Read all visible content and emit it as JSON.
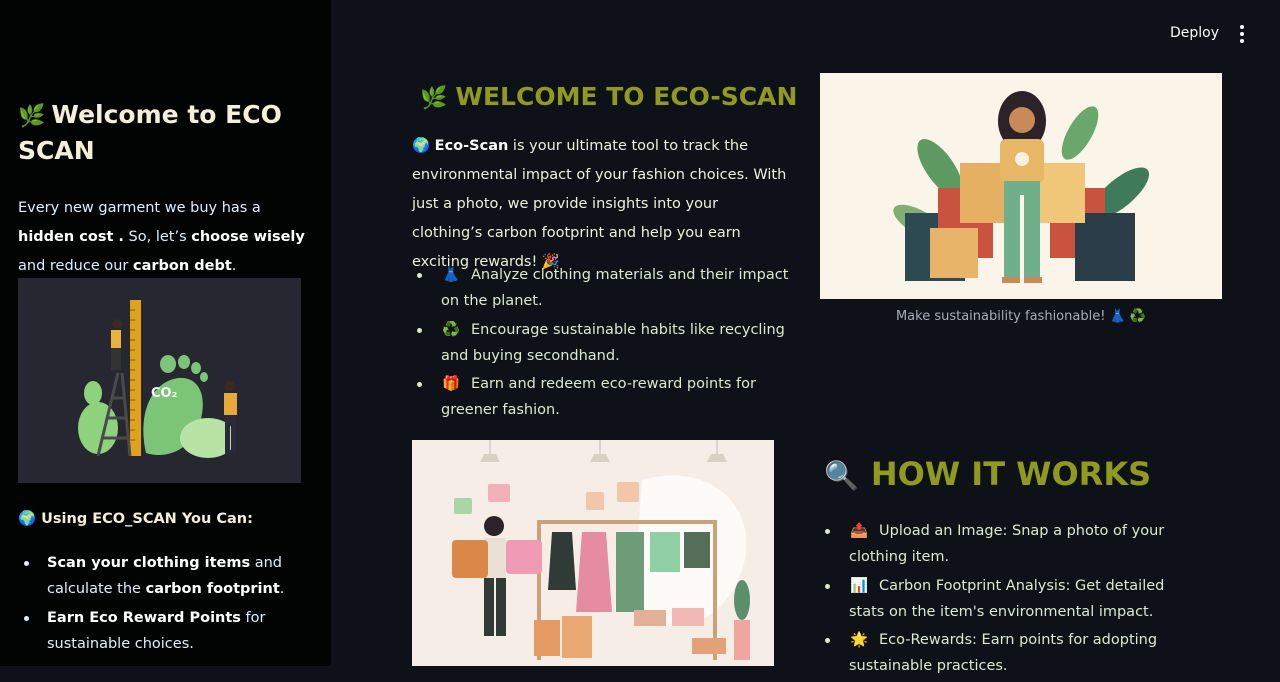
{
  "topbar": {
    "deploy_label": "Deploy"
  },
  "sidebar": {
    "title_icon": "🌿",
    "title": "Welcome to ECO SCAN",
    "intro": {
      "p1": "Every new garment we buy has a ",
      "b1": "hidden cost .",
      "p2": " So, let’s ",
      "b2": "choose wisely",
      "p3": " and reduce our ",
      "b3": "carbon debt",
      "p4": "."
    },
    "subhead_icon": "🌍",
    "subhead": "Using ECO_SCAN You Can:",
    "items": [
      {
        "b": "Scan your clothing items",
        "t1": " and calculate the ",
        "b2": "carbon footprint",
        "t2": "."
      },
      {
        "b": "Earn Eco Reward Points",
        "t1": " for sustainable choices.",
        "b2": "",
        "t2": ""
      }
    ]
  },
  "main": {
    "title_icon": "🌿",
    "title": "WELCOME TO ECO-SCAN",
    "intro": {
      "icon": "🌍",
      "brand": "Eco-Scan",
      "text": " is your ultimate tool to track the environmental impact of your fashion choices. With just a photo, we provide insights into your clothing’s carbon footprint and help you earn exciting rewards! ",
      "end_icon": "🎉"
    },
    "features": [
      {
        "icon": "👗",
        "text": "Analyze clothing materials and their impact on the planet."
      },
      {
        "icon": "♻️",
        "text": "Encourage sustainable habits like recycling and buying secondhand."
      },
      {
        "icon": "🎁",
        "text": "Earn and redeem eco-reward points for greener fashion."
      }
    ],
    "hero_caption": "Make sustainability fashionable! 👗 ♻️",
    "how_icon": "🔍",
    "how_title": "HOW IT WORKS",
    "how_items": [
      {
        "icon": "📤",
        "text": "Upload an Image: Snap a photo of your clothing item."
      },
      {
        "icon": "📊",
        "text": "Carbon Footprint Analysis: Get detailed stats on the item's environmental impact."
      },
      {
        "icon": "🌟",
        "text": "Eco-Rewards: Earn points for adopting sustainable practices."
      }
    ]
  },
  "images": {
    "sidebar_co2_label": "CO₂"
  }
}
